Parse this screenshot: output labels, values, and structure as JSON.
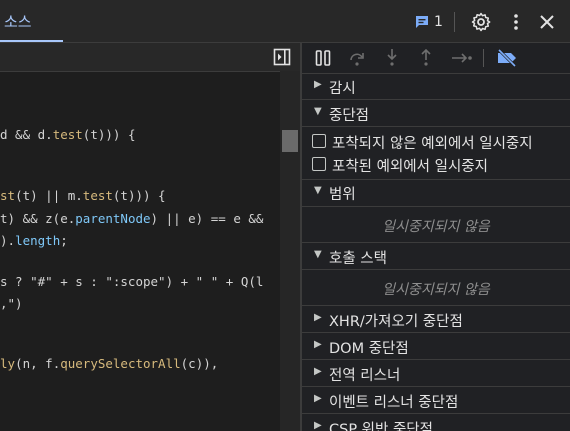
{
  "top_tab": "소스",
  "issues_count": "1",
  "code_lines": [
    {
      "parts": [
        [
          "plain",
          "d && d."
        ],
        [
          "fn",
          "test"
        ],
        [
          "plain",
          "(t))) {"
        ]
      ]
    },
    {
      "parts": [
        [
          "fn",
          "st"
        ],
        [
          "plain",
          "(t) || m."
        ],
        [
          "fn",
          "test"
        ],
        [
          "plain",
          "(t))) {"
        ]
      ]
    },
    {
      "parts": [
        [
          "plain",
          "t) && z(e."
        ],
        [
          "mem",
          "parentNode"
        ],
        [
          "plain",
          ") || e) == e &&"
        ]
      ]
    },
    {
      "parts": [
        [
          "plain",
          ")."
        ],
        [
          "mem",
          "length"
        ],
        [
          "plain",
          ";"
        ]
      ]
    },
    {
      "parts": [
        [
          "plain",
          "s ? \"#\" + s : \":scope\") + \" \" + Q(l"
        ]
      ]
    },
    {
      "parts": [
        [
          "plain",
          ",\")"
        ]
      ]
    },
    {
      "parts": [
        [
          "fn",
          "ly"
        ],
        [
          "plain",
          "(n, f."
        ],
        [
          "fn",
          "querySelectorAll"
        ],
        [
          "plain",
          "(c)),"
        ]
      ]
    }
  ],
  "panel": {
    "watch": "감시",
    "breakpoints": "중단점",
    "pause_uncaught": "포착되지 않은 예외에서 일시중지",
    "pause_caught": "포착된 예외에서 일시중지",
    "scope": "범위",
    "scope_empty": "일시중지되지 않음",
    "call_stack": "호출 스택",
    "call_stack_empty": "일시중지되지 않음",
    "xhr": "XHR/가져오기 중단점",
    "dom": "DOM 중단점",
    "global": "전역 리스너",
    "event": "이벤트 리스너 중단점",
    "csp": "CSP 위반 중단점"
  },
  "colors": {
    "accent": "#a8c7fa",
    "badge": "#7cacf8"
  }
}
